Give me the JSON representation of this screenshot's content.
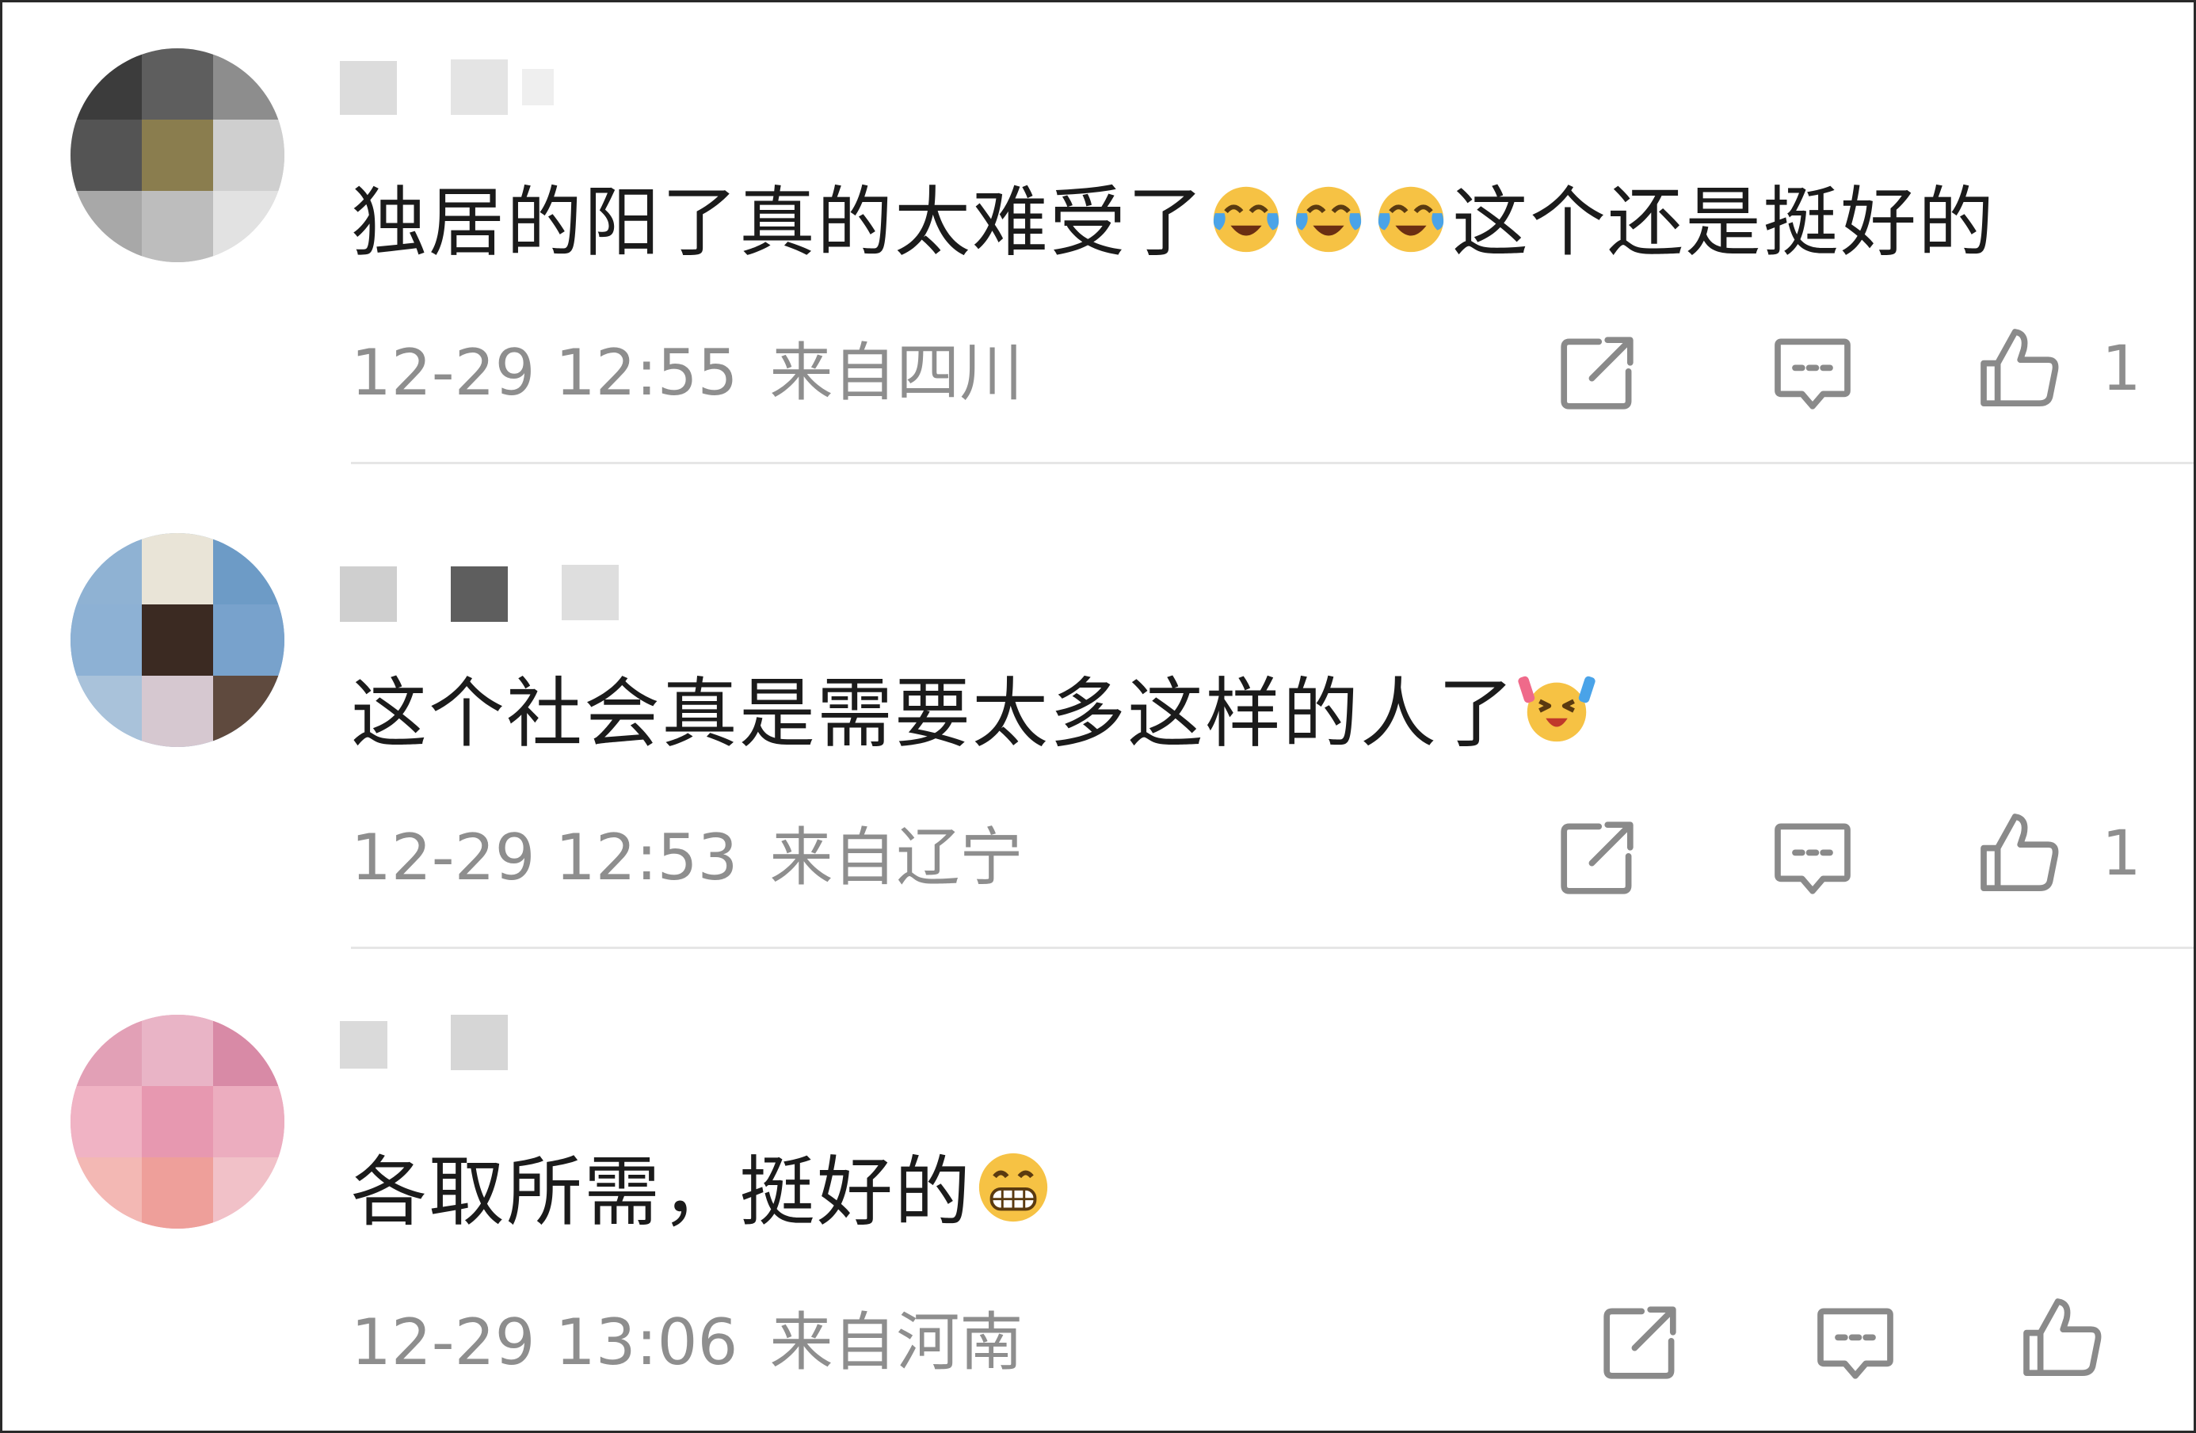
{
  "comments": [
    {
      "text_before": "独居的阳了真的太难受了",
      "text_after": "这个还是挺好的",
      "emojis": [
        "laugh-cry-emoji",
        "laugh-cry-emoji",
        "laugh-cry-emoji"
      ],
      "date_time": "12-29 12:55",
      "location": "来自四川",
      "like_count": "1"
    },
    {
      "text_before": "这个社会真是需要太多这样的人了",
      "text_after": "",
      "emojis": [
        "cheer-emoji"
      ],
      "date_time": "12-29 12:53",
      "location": "来自辽宁",
      "like_count": "1"
    },
    {
      "text_before": "各取所需，挺好的",
      "text_after": "",
      "emojis": [
        "grin-emoji"
      ],
      "date_time": "12-29 13:06",
      "location": "来自河南",
      "like_count": ""
    }
  ],
  "colors": {
    "text": "#1b1b1b",
    "meta": "#8e8e8e",
    "icon": "#8a8a8a",
    "divider": "#e6e6e6"
  }
}
